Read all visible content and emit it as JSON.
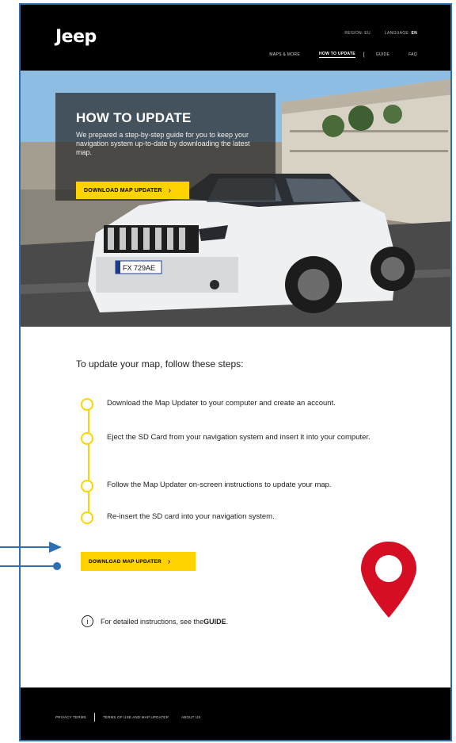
{
  "header": {
    "logo": "Jeep",
    "region_label": "REGION: EU",
    "language_label": "LANGUAGE: ",
    "language_value": "EN",
    "nav": [
      "MAPS & MORE",
      "HOW TO UPDATE",
      "GUIDE",
      "FAQ"
    ]
  },
  "hero": {
    "title": "HOW TO UPDATE",
    "text": "We prepared a step-by-step guide for you to keep your navigation system up-to-date by downloading the latest map.",
    "button_label": "DOWNLOAD MAP UPDATER",
    "plate": "FX 729AE"
  },
  "main": {
    "intro": "To update your map, follow these steps:",
    "steps": [
      "Download the Map Updater to your computer and create an account.",
      "Eject the SD Card from your navigation system and insert it into your computer.",
      "Follow the Map Updater on-screen instructions to update your map.",
      "Re-insert the SD card into your navigation system."
    ],
    "button_label": "DOWNLOAD MAP UPDATER",
    "info_prefix": "For detailed instructions, see the ",
    "info_link": "GUIDE",
    "info_suffix": ".",
    "info_icon_glyph": "i"
  },
  "footer": {
    "links": [
      "PRIVACY TERMS",
      "TERMS OF USE AND MAP UPDATER",
      "ABOUT US"
    ]
  },
  "colors": {
    "accent": "#ffd300",
    "pin": "#d50e24",
    "frame": "#2d6fb0",
    "header_bg": "#000000"
  }
}
